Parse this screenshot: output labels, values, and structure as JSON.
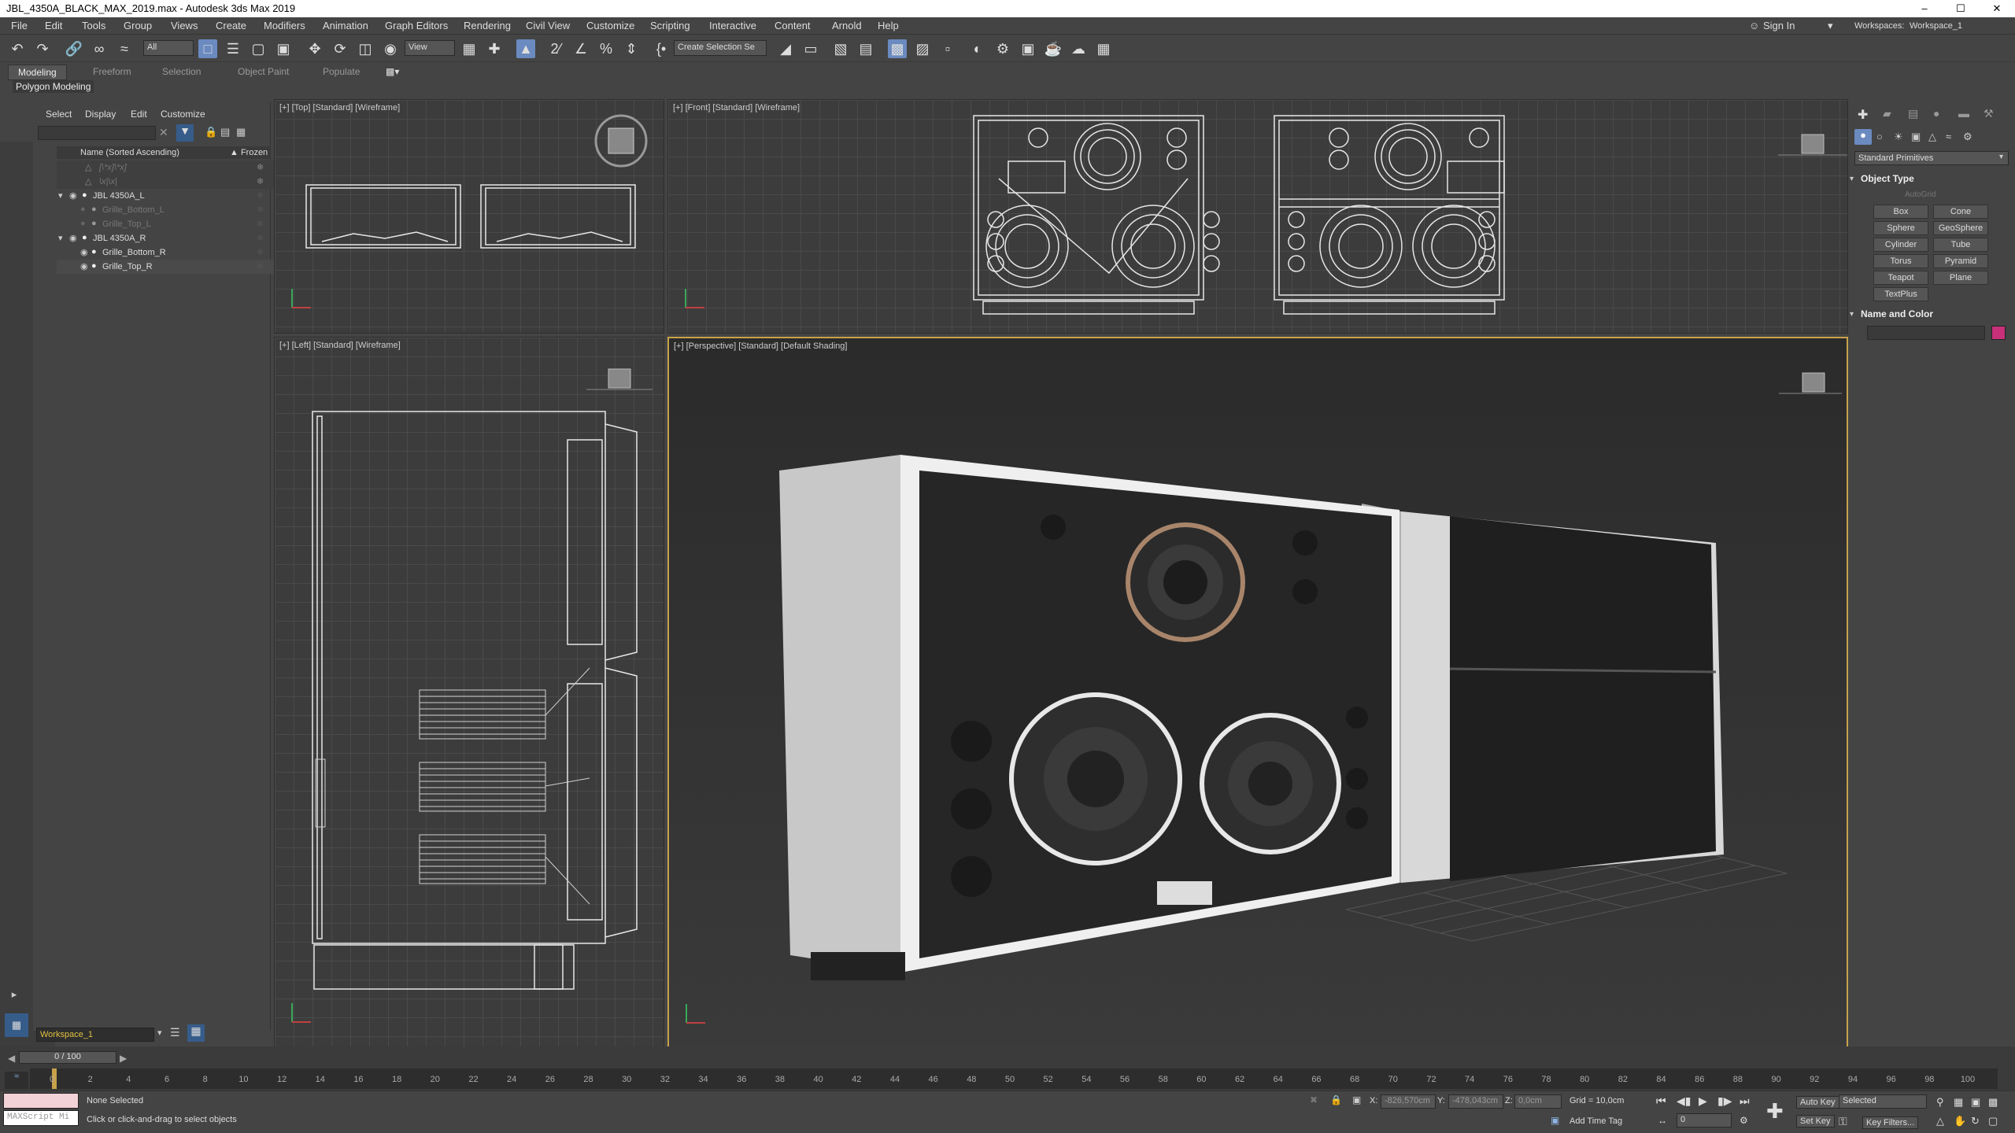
{
  "window": {
    "title": "JBL_4350A_BLACK_MAX_2019.max - Autodesk 3ds Max 2019",
    "minimize": "–",
    "maximize": "☐",
    "close": "✕"
  },
  "menu": [
    "File",
    "Edit",
    "Tools",
    "Group",
    "Views",
    "Create",
    "Modifiers",
    "Animation",
    "Graph Editors",
    "Rendering",
    "Civil View",
    "Customize",
    "Scripting",
    "Interactive",
    "Content",
    "Arnold",
    "Help"
  ],
  "account": {
    "sign_in": "Sign In",
    "workspaces_label": "Workspaces:",
    "workspace_value": "Workspace_1"
  },
  "toolbar": {
    "filter_value": "All",
    "coord_value": "View",
    "selection_set_placeholder": "Create Selection Se"
  },
  "ribbon": {
    "tabs": [
      "Modeling",
      "Freeform",
      "Selection",
      "Object Paint",
      "Populate"
    ],
    "active_tab": "Modeling",
    "sub_label": "Polygon Modeling"
  },
  "scene_explorer": {
    "tabs": [
      "Select",
      "Display",
      "Edit",
      "Customize"
    ],
    "column_name": "Name (Sorted Ascending)",
    "column_frozen": "▲ Frozen",
    "rows": [
      {
        "label": "[\\*x]\\*x]",
        "dim": true
      },
      {
        "label": "\\x|\\x|",
        "dim": true
      },
      {
        "label": "JBL 4350A_L",
        "dim": false
      },
      {
        "label": "Grille_Bottom_L",
        "dim": true
      },
      {
        "label": "Grille_Top_L",
        "dim": true
      },
      {
        "label": "JBL 4350A_R",
        "dim": false
      },
      {
        "label": "Grille_Bottom_R",
        "dim": false
      },
      {
        "label": "Grille_Top_R",
        "dim": false
      }
    ],
    "workspace_field": "Workspace_1"
  },
  "viewports": {
    "top": "[+] [Top] [Standard] [Wireframe]",
    "front": "[+] [Front] [Standard] [Wireframe]",
    "left": "[+] [Left] [Standard] [Wireframe]",
    "perspective": "[+] [Perspective] [Standard] [Default Shading]"
  },
  "command_panel": {
    "dropdown": "Standard Primitives",
    "object_type_header": "Object Type",
    "autogrid": "AutoGrid",
    "buttons": [
      "Box",
      "Cone",
      "Sphere",
      "GeoSphere",
      "Cylinder",
      "Tube",
      "Torus",
      "Pyramid",
      "Teapot",
      "Plane",
      "TextPlus"
    ],
    "name_color_header": "Name and Color",
    "object_color": "#c8307a"
  },
  "timeline": {
    "frame_counter": "0 / 100",
    "ticks": [
      "0",
      "2",
      "4",
      "6",
      "8",
      "10",
      "12",
      "14",
      "16",
      "18",
      "20",
      "22",
      "24",
      "26",
      "28",
      "30",
      "32",
      "34",
      "36",
      "38",
      "40",
      "42",
      "44",
      "46",
      "48",
      "50",
      "52",
      "54",
      "56",
      "58",
      "60",
      "62",
      "64",
      "66",
      "68",
      "70",
      "72",
      "74",
      "76",
      "78",
      "80",
      "82",
      "84",
      "86",
      "88",
      "90",
      "92",
      "94",
      "96",
      "98",
      "100"
    ]
  },
  "status": {
    "maxscript": "MAXScript Mi",
    "selection": "None Selected",
    "prompt": "Click or click-and-drag to select objects",
    "x_label": "X:",
    "x_value": "-826,570cm",
    "y_label": "Y:",
    "y_value": "-478,043cm",
    "z_label": "Z:",
    "z_value": "0,0cm",
    "grid": "Grid = 10,0cm",
    "add_time_tag": "Add Time Tag",
    "auto_key": "Auto Key",
    "selected": "Selected",
    "set_key": "Set Key",
    "key_filters": "Key Filters...",
    "frame": "0"
  },
  "colors": {
    "accent": "#6a8ac0",
    "active_viewport_border": "#c8a24a",
    "ui_background": "#444444"
  }
}
